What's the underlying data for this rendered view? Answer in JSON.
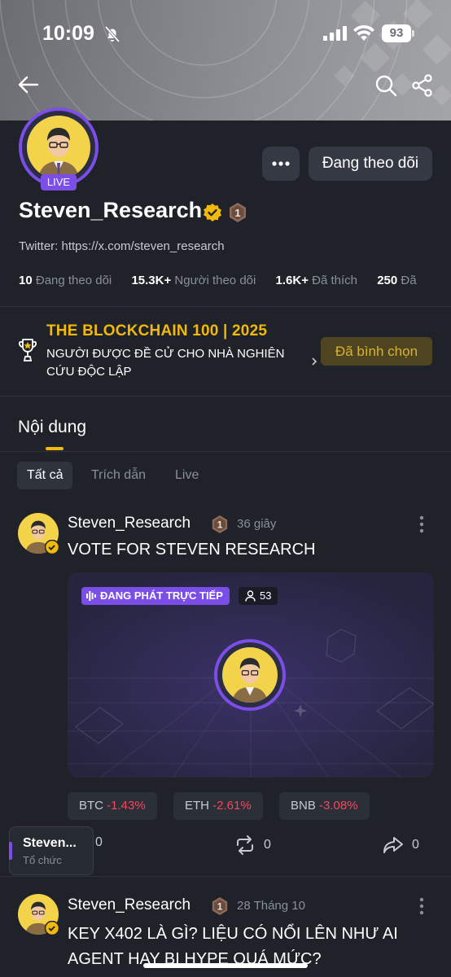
{
  "status_bar": {
    "time": "10:09",
    "battery": "93"
  },
  "header": {
    "back_icon": "arrow-left-icon",
    "search_icon": "search-icon",
    "share_icon": "share-icon"
  },
  "profile": {
    "live_label": "LIVE",
    "name": "Steven_Research",
    "rank": "1",
    "bio": "Twitter: https://x.com/steven_research",
    "more_button": "···",
    "follow_button": "Đang theo dõi",
    "stats": [
      {
        "value": "10",
        "label": "Đang theo dõi"
      },
      {
        "value": "15.3K+",
        "label": "Người theo dõi"
      },
      {
        "value": "1.6K+",
        "label": "Đã thích"
      },
      {
        "value": "250",
        "label": "Đã"
      }
    ]
  },
  "award": {
    "title": "THE BLOCKCHAIN 100 | 2025",
    "description": "NGƯỜI ĐƯỢC ĐỀ CỬ CHO NHÀ NGHIÊN CỨU ĐỘC LẬP",
    "button": "Đã bình chọn"
  },
  "tabs": {
    "main": "Nội dung",
    "filters": [
      "Tất cả",
      "Trích dẫn",
      "Live"
    ],
    "active_filter": "Tất cả"
  },
  "posts": [
    {
      "author": "Steven_Research",
      "rank": "1",
      "time": "36 giây",
      "text": "VOTE FOR STEVEN RESEARCH",
      "live_label": "ĐANG PHÁT TRỰC TIẾP",
      "viewers": "53",
      "tickers": [
        {
          "symbol": "BTC",
          "change": "-1.43%"
        },
        {
          "symbol": "ETH",
          "change": "-2.61%"
        },
        {
          "symbol": "BNB",
          "change": "-3.08%"
        }
      ],
      "comments": "0",
      "reposts": "0",
      "shares": "0"
    },
    {
      "author": "Steven_Research",
      "rank": "1",
      "time": "28 Tháng 10",
      "text": "KEY X402 LÀ GÌ? LIỆU CÓ NỔI LÊN NHƯ AI AGENT HAY BỊ HYPE QUÁ MỨC?"
    }
  ],
  "org_chip": {
    "name": "Steven...",
    "role": "Tổ chức"
  },
  "colors": {
    "accent": "#f0b90b",
    "live": "#7b4ee8",
    "negative": "#f6465d",
    "background": "#1f2229"
  }
}
